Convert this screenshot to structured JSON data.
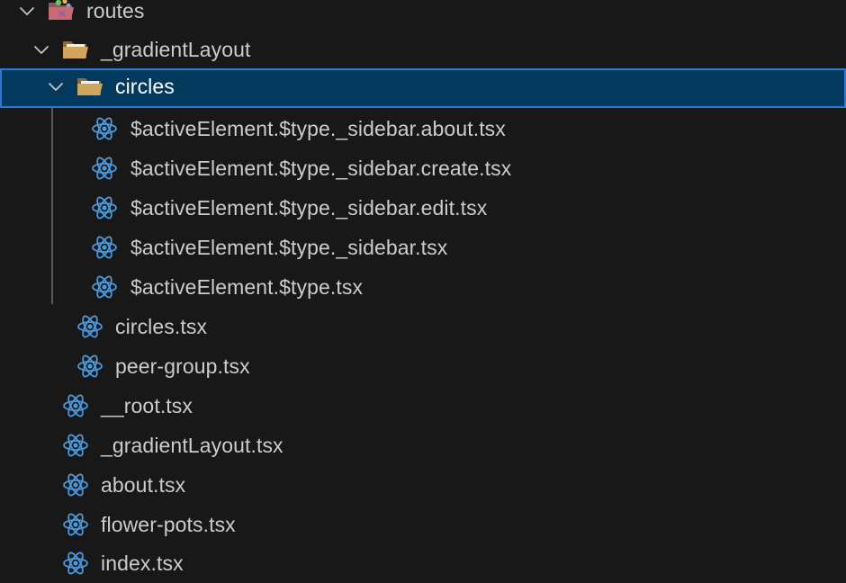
{
  "tree": {
    "routes_label": "routes",
    "gradient_layout_label": "_gradientLayout",
    "circles_label": "circles",
    "circles_children": [
      "$activeElement.$type._sidebar.about.tsx",
      "$activeElement.$type._sidebar.create.tsx",
      "$activeElement.$type._sidebar.edit.tsx",
      "$activeElement.$type._sidebar.tsx",
      "$activeElement.$type.tsx"
    ],
    "gradient_layout_files": [
      "circles.tsx",
      "peer-group.tsx"
    ],
    "routes_files": [
      "__root.tsx",
      "_gradientLayout.tsx",
      "about.tsx",
      "flower-pots.tsx",
      "index.tsx"
    ]
  },
  "colors": {
    "background": "#181818",
    "selection_background": "#04395e",
    "selection_border": "#2b79d6",
    "text": "#cccccc",
    "react_icon": "#4a9be0",
    "folder_icon": "#c09553"
  },
  "icons": {
    "chevron": "chevron-down-icon",
    "folder_open": "folder-open-icon",
    "routes_folder": "routes-folder-icon",
    "react_file": "react-file-icon"
  }
}
